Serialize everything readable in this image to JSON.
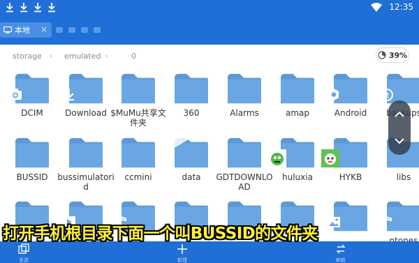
{
  "status_bar": {
    "time": "12:35",
    "download_icons": [
      "download-icon",
      "download-icon",
      "download-icon",
      "download-icon"
    ]
  },
  "title_bar": {
    "tab_label": "本地",
    "tab_close": "×"
  },
  "breadcrumb": [
    "storage",
    "emulated",
    "0"
  ],
  "storage_usage": "39%",
  "colors": {
    "primary": "#1f6fd6",
    "folder": "#6aa6e3",
    "folder_back": "#5d98d6",
    "subtitle": "#fff23a"
  },
  "folders": [
    {
      "name": "DCIM",
      "overlay": "camera-icon"
    },
    {
      "name": "Download",
      "overlay": "download-icon"
    },
    {
      "name": "$MuMu共享文件夹",
      "overlay": ""
    },
    {
      "name": "360",
      "overlay": ""
    },
    {
      "name": "Alarms",
      "overlay": ""
    },
    {
      "name": "amap",
      "overlay": ""
    },
    {
      "name": "Android",
      "overlay": "gear-icon"
    },
    {
      "name": "backups",
      "overlay": "es-backup-icon"
    },
    {
      "name": "BUSSID",
      "overlay": ""
    },
    {
      "name": "bussimulatorid",
      "overlay": ""
    },
    {
      "name": "ccmini",
      "overlay": ""
    },
    {
      "name": "data",
      "overlay": ""
    },
    {
      "name": "GDTDOWNLOAD",
      "overlay": ""
    },
    {
      "name": "huluxia",
      "overlay": "huluxia-app-icon"
    },
    {
      "name": "HYKB",
      "overlay": "hykb-app-icon"
    },
    {
      "name": "libs",
      "overlay": ""
    },
    {
      "name": "",
      "overlay": ""
    },
    {
      "name": "",
      "overlay": "video-icon"
    },
    {
      "name": "",
      "overlay": "music-icon"
    },
    {
      "name": "",
      "overlay": ""
    },
    {
      "name": "",
      "overlay": ""
    },
    {
      "name": "",
      "overlay": ""
    },
    {
      "name": "",
      "overlay": "image-icon"
    },
    {
      "name": "ntones",
      "overlay": "music-icon"
    }
  ],
  "subtitle": "打开手机根目录下面一个叫BUSSID的文件夹",
  "bottom_bar": [
    {
      "label": "多选",
      "icon": "multi-select-icon"
    },
    {
      "label": "新建",
      "icon": "plus-icon"
    },
    {
      "label": "刷新",
      "icon": "refresh-icon"
    }
  ]
}
